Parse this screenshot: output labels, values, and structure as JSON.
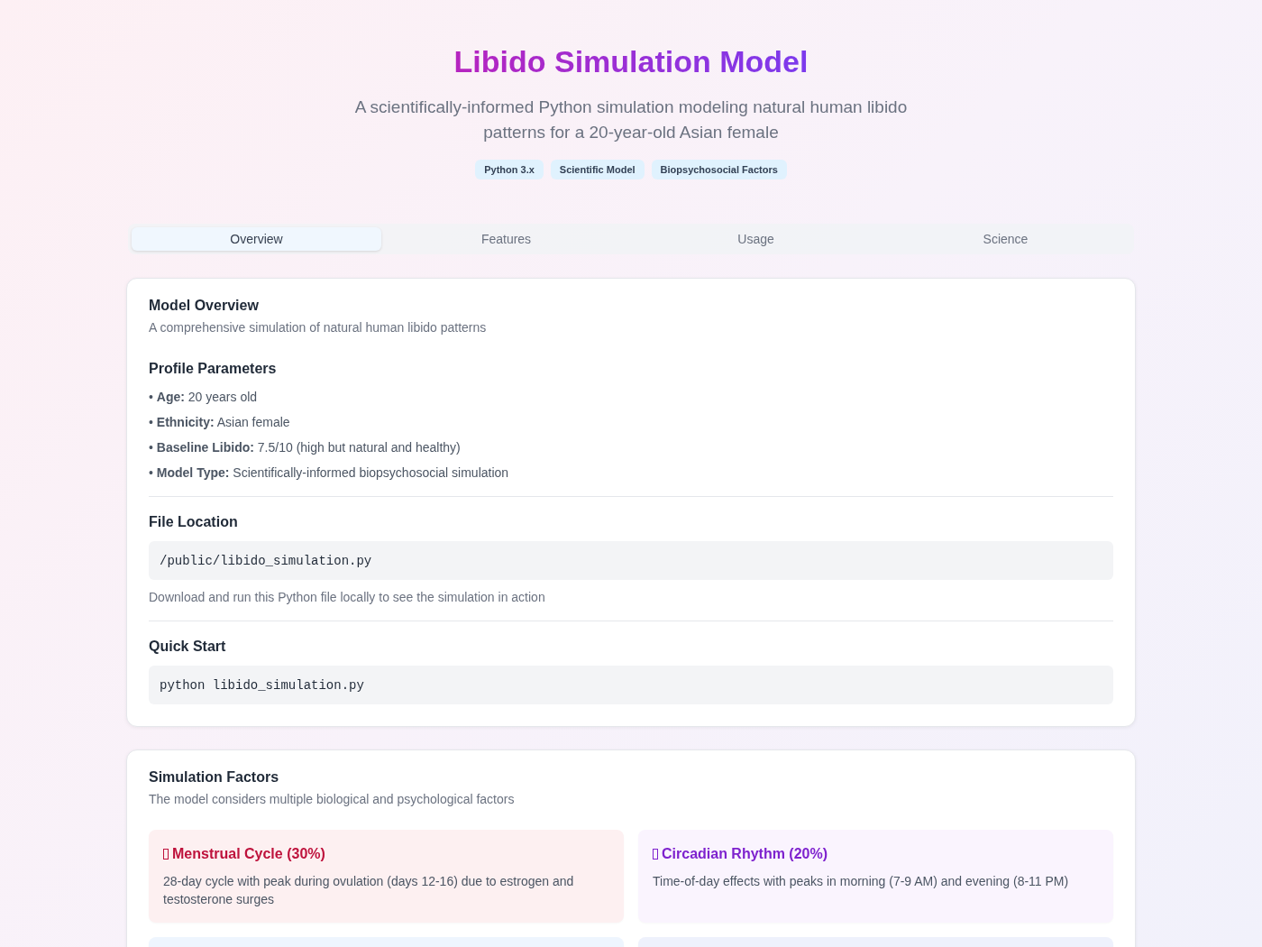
{
  "header": {
    "title": "Libido Simulation Model",
    "subtitle": "A scientifically-informed Python simulation modeling natural human libido patterns for a 20-year-old Asian female",
    "badges": [
      "Python 3.x",
      "Scientific Model",
      "Biopsychosocial Factors"
    ]
  },
  "tabs": [
    {
      "label": "Overview",
      "selected": true
    },
    {
      "label": "Features",
      "selected": false
    },
    {
      "label": "Usage",
      "selected": false
    },
    {
      "label": "Science",
      "selected": false
    }
  ],
  "overview": {
    "title": "Model Overview",
    "description": "A comprehensive simulation of natural human libido patterns",
    "sections": [
      {
        "kind": "list",
        "heading": "Profile Parameters",
        "items": [
          "• **Age:** 20 years old",
          "• **Ethnicity:** Asian female",
          "• **Baseline Libido:** 7.5/10 (high but natural and healthy)",
          "• **Model Type:** Scientifically-informed biopsychosocial simulation"
        ]
      },
      {
        "kind": "code",
        "heading": "File Location",
        "code": "/public/libido_simulation.py",
        "note": "Download and run this Python file locally to see the simulation in action"
      },
      {
        "kind": "code",
        "heading": "Quick Start",
        "code": "python libido_simulation.py"
      }
    ]
  },
  "factors": {
    "title": "Simulation Factors",
    "description": "The model considers multiple biological and psychological factors",
    "items": [
      {
        "kind": "rose",
        "title": "Menstrual Cycle (30%)",
        "description": "28-day cycle with peak during ovulation (days 12-16) due to estrogen and testosterone surges"
      },
      {
        "kind": "violet",
        "title": "Circadian Rhythm (20%)",
        "description": "Time-of-day effects with peaks in morning (7-9 AM) and evening (8-11 PM)"
      },
      {
        "kind": "blue"
      },
      {
        "kind": "indigo"
      }
    ]
  }
}
